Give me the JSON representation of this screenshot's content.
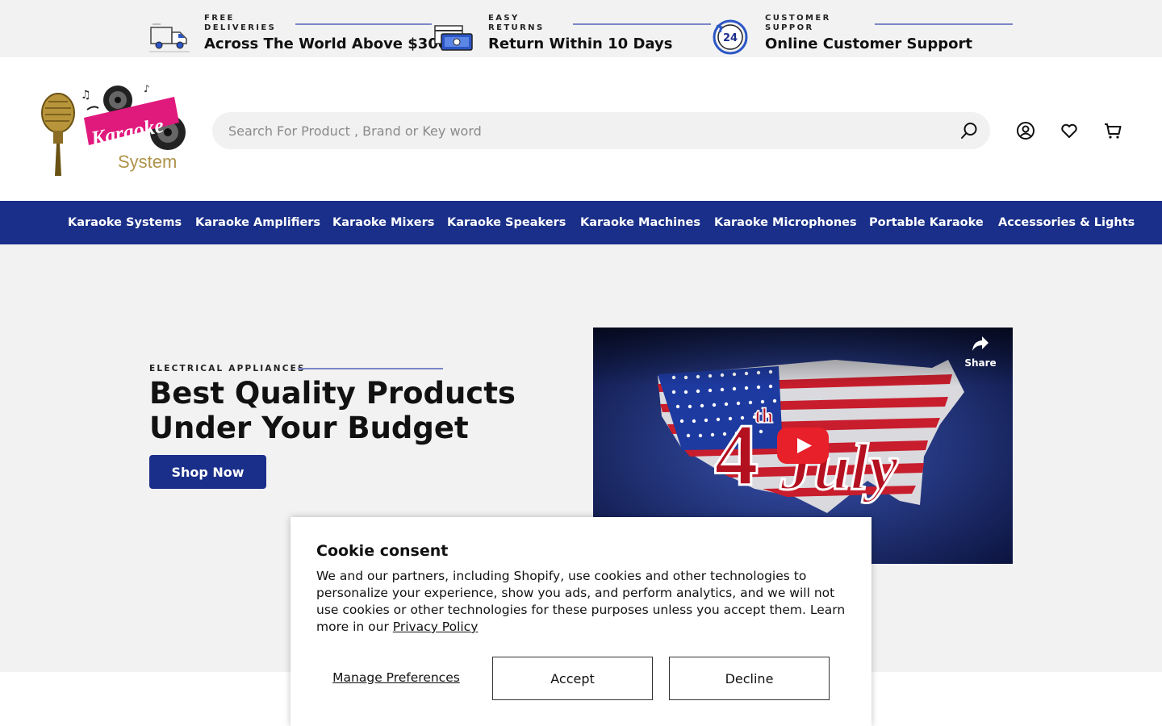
{
  "topbar": {
    "features": [
      {
        "small": "FREE\nDELIVERIES",
        "big": "Across The World Above $300",
        "icon": "delivery-truck-icon"
      },
      {
        "small": "EASY\nRETURNS",
        "big": "Return Within 10 Days",
        "icon": "money-return-icon"
      },
      {
        "small": "CUSTOMER\nSUPPOR",
        "big": "Online Customer Support",
        "icon": "support-24-icon",
        "badge": "24"
      }
    ]
  },
  "header": {
    "logo_text_main": "Karaoke",
    "logo_text_sub": "System",
    "search_placeholder": "Search For Product , Brand or Key word",
    "search_value": ""
  },
  "nav": {
    "items": [
      "Karaoke Systems",
      "Karaoke Amplifiers",
      "Karaoke Mixers",
      "Karaoke Speakers",
      "Karaoke Machines",
      "Karaoke Microphones",
      "Portable Karaoke",
      "Accessories & Lights"
    ]
  },
  "hero": {
    "eyebrow": "ELECTRICAL APPLIANCES",
    "headline": "Best Quality Products Under Your Budget",
    "cta": "Shop Now",
    "video": {
      "share_label": "Share",
      "title_number": "4",
      "title_suffix": "th",
      "title_word": "July"
    }
  },
  "cookie": {
    "title": "Cookie consent",
    "body": "We and our partners, including Shopify, use cookies and other technologies to personalize your experience, show you ads, and perform analytics, and we will not use cookies or other technologies for these purposes unless you accept them. Learn more in our ",
    "link": "Privacy Policy",
    "manage": "Manage Preferences",
    "accept": "Accept",
    "decline": "Decline"
  },
  "colors": {
    "brand_blue": "#1a2f8a",
    "accent_line": "#7d86c7",
    "hero_bg": "#f2f2f2",
    "logo_pink": "#e0197d"
  }
}
